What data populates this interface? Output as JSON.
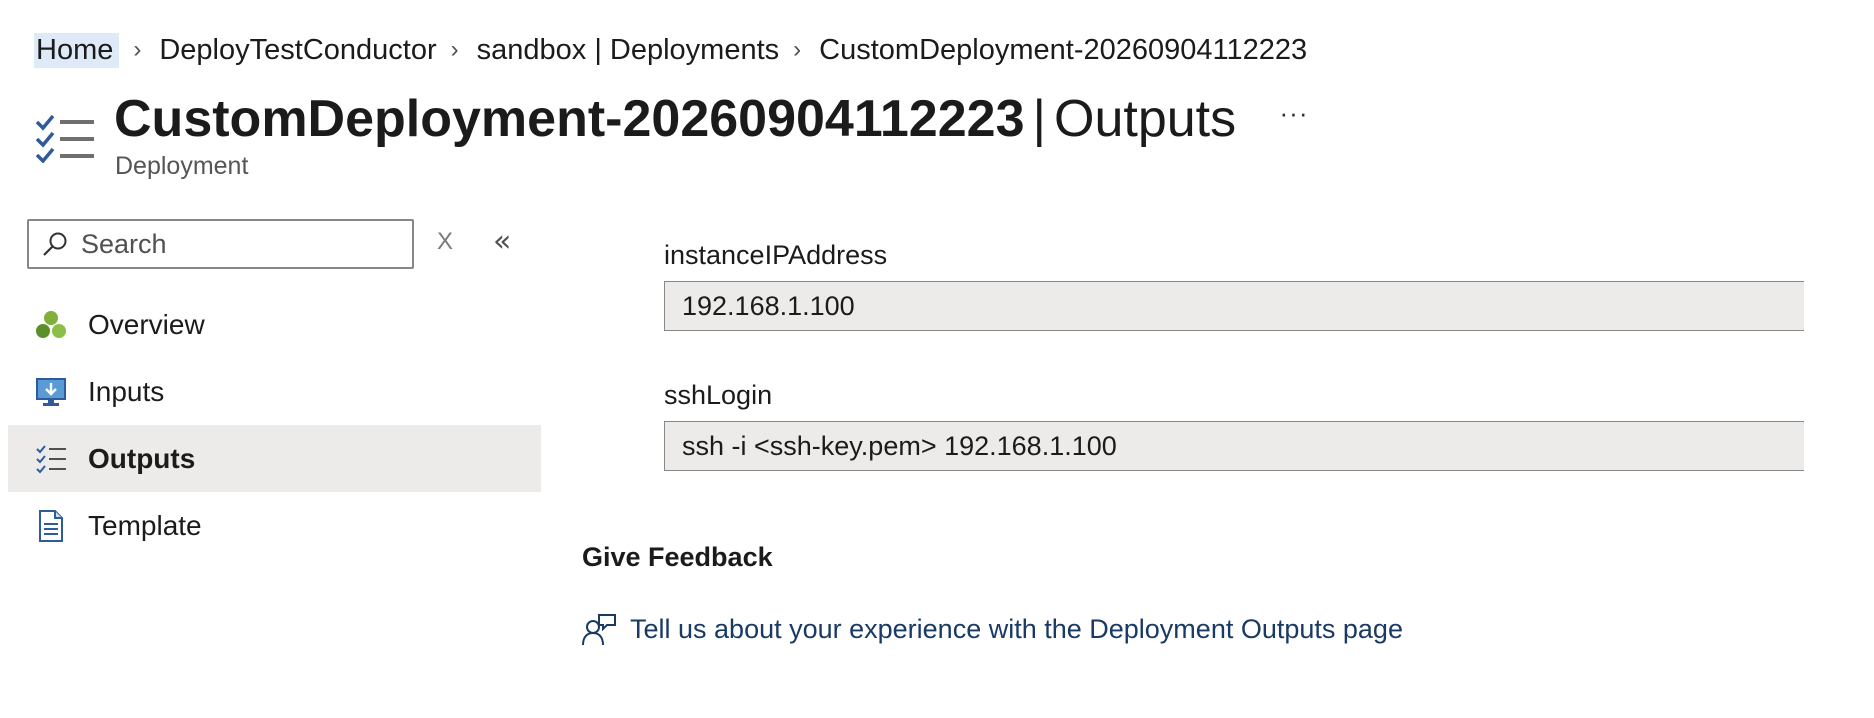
{
  "breadcrumb": {
    "items": [
      "Home",
      "DeployTestConductor",
      "sandbox | Deployments",
      "CustomDeployment-20260904112223"
    ],
    "separator": "›"
  },
  "header": {
    "title": "CustomDeployment-20260904112223",
    "title_separator": "|",
    "section": "Outputs",
    "resource_type": "Deployment",
    "more_label": "···"
  },
  "sidebar": {
    "search": {
      "placeholder": "Search",
      "value": ""
    },
    "clear_label": "X",
    "collapse_label": "«",
    "items": [
      {
        "label": "Overview",
        "icon": "overview-icon",
        "selected": false
      },
      {
        "label": "Inputs",
        "icon": "inputs-icon",
        "selected": false
      },
      {
        "label": "Outputs",
        "icon": "outputs-icon",
        "selected": true
      },
      {
        "label": "Template",
        "icon": "template-icon",
        "selected": false
      }
    ]
  },
  "outputs": [
    {
      "name": "instanceIPAddress",
      "value": "192.168.1.100"
    },
    {
      "name": "sshLogin",
      "value": "ssh -i <ssh-key.pem> 192.168.1.100"
    }
  ],
  "feedback": {
    "heading": "Give Feedback",
    "link_text": "Tell us about your experience with the Deployment Outputs page"
  },
  "colors": {
    "selected_nav_bg": "#edebe9",
    "readonly_field_bg": "#edebe9",
    "home_highlight": "#deeaf7",
    "link": "#1a3a66",
    "icon_blue": "#2e5c9a"
  }
}
